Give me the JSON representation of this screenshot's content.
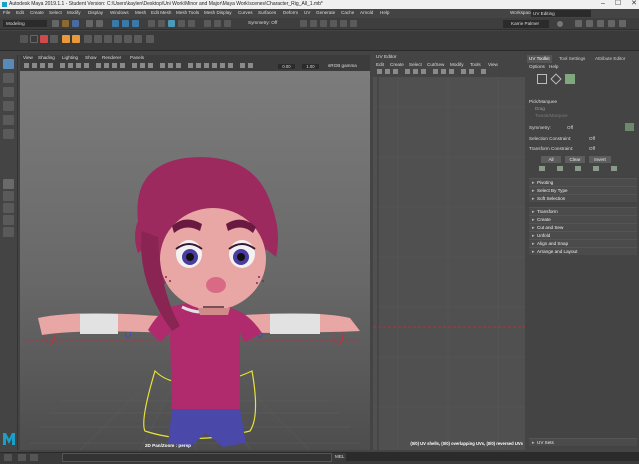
{
  "window": {
    "title": "Autodesk Maya 2019.1.1 - Student Version: C:\\Users\\kaylen\\Desktop\\Uni Work\\Minor and Major\\Maya Work\\scenes\\Character_Rig_All_1.mb*",
    "controls": [
      "–",
      "☐",
      "✕"
    ]
  },
  "menus": [
    "File",
    "Edit",
    "Create",
    "Select",
    "Modify",
    "Display",
    "Windows",
    "Mesh",
    "Edit Mesh",
    "Mesh Tools",
    "Mesh Display",
    "Curves",
    "Surfaces",
    "Deform",
    "UV",
    "Generate",
    "Cache",
    "Arnold",
    "Help"
  ],
  "status_line": {
    "mode": "Modeling",
    "symmetry": "Symmetry: Off",
    "workspace_label": "Workspace :",
    "workspace": "UV Editing",
    "user": "Karrie Palmer"
  },
  "viewport": {
    "menus": [
      "View",
      "Shading",
      "Lighting",
      "Show",
      "Renderer",
      "Panels"
    ],
    "value_a": "0.00",
    "value_b": "1.00",
    "color_space": "sRGB gamma",
    "camera_label": "2D Pan/Zoom : persp"
  },
  "uv_editor": {
    "title": "UV Editor",
    "menus": [
      "Edit",
      "Create",
      "Select",
      "Cut/Sew",
      "Modify",
      "Tools",
      "View"
    ],
    "status": "(0/0) UV shells, (0/0) overlapping UVs, (0/0) reversed UVs"
  },
  "uv_toolkit": {
    "tabs": [
      "UV Toolkit",
      "Tool Settings",
      "Attribute Editor"
    ],
    "menus": [
      "Options",
      "Help"
    ],
    "pick_modes": [
      "Pick/Marquee",
      "Drag",
      "Tweak/Marquee"
    ],
    "symmetry_label": "Symmetry:",
    "symmetry_value": "Off",
    "selection_constraint_label": "Selection Constraint:",
    "selection_constraint_value": "Off",
    "transform_constraint_label": "Transform Constraint:",
    "transform_constraint_value": "Off",
    "buttons": [
      "All",
      "Clear",
      "Invert"
    ],
    "sections": [
      "Pivoting",
      "Select By Type",
      "Soft Selection",
      "Transform",
      "Create",
      "Cut and Sew",
      "Unfold",
      "Align and Snap",
      "Arrange and Layout"
    ],
    "uv_sets": "UV Sets"
  },
  "bottom": {
    "mel_label": "MEL"
  },
  "colors": {
    "maya_logo": "#1aa0c8",
    "character_hair": "#9c2a5e",
    "character_shirt": "#b02a6e",
    "character_skin": "#e8a6a4",
    "rig_yellow": "#e8e23a",
    "rig_red": "#cc2a3a",
    "rig_blue": "#3a48cc"
  }
}
